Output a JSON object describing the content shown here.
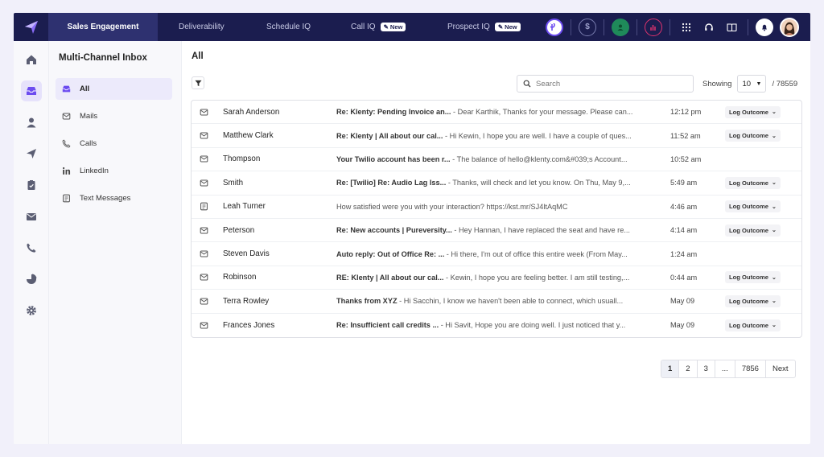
{
  "topnav": {
    "tabs": [
      {
        "label": "Sales Engagement",
        "active": true
      },
      {
        "label": "Deliverability"
      },
      {
        "label": "Schedule IQ"
      },
      {
        "label": "Call IQ",
        "badge": "✎ New"
      },
      {
        "label": "Prospect IQ",
        "badge": "✎ New"
      }
    ],
    "icons": [
      "play-circle-icon",
      "dollar-circle-icon",
      "user-circle-icon",
      "analytics-icon",
      "dialpad-icon",
      "headset-icon",
      "book-icon",
      "bell-icon",
      "avatar"
    ]
  },
  "rail": {
    "icons": [
      "home-icon",
      "inbox-icon",
      "contacts-icon",
      "send-icon",
      "tasks-icon",
      "mail-icon",
      "phone-icon",
      "reports-icon",
      "settings-icon"
    ],
    "active": "inbox-icon"
  },
  "subnav": {
    "title": "Multi-Channel Inbox",
    "items": [
      {
        "label": "All",
        "icon": "inbox-icon",
        "active": true
      },
      {
        "label": "Mails",
        "icon": "mail-icon"
      },
      {
        "label": "Calls",
        "icon": "phone-icon"
      },
      {
        "label": "LinkedIn",
        "icon": "linkedin-icon"
      },
      {
        "label": "Text Messages",
        "icon": "sms-icon"
      }
    ]
  },
  "main": {
    "title": "All",
    "search_placeholder": "Search",
    "showing_label": "Showing",
    "page_size": "10",
    "total": "/ 78559"
  },
  "rows": [
    {
      "type": "mail",
      "name": "Sarah Anderson",
      "subject": "Re: Klenty: Pending Invoice an...",
      "preview": " - Dear Karthik, Thanks for your message. Please can...",
      "time": "12:12 pm",
      "outcome": "Log Outcome"
    },
    {
      "type": "mail",
      "name": "Matthew Clark",
      "subject": "Re: Klenty | All about our cal...",
      "preview": " - Hi Kewin, I hope you are well. I have a couple of ques...",
      "time": "11:52 am",
      "outcome": "Log Outcome"
    },
    {
      "type": "mail",
      "name": "Thompson",
      "subject": "Your Twilio account has been r...",
      "preview": " - The balance of hello@klenty.com&#039;s Account...",
      "time": "10:52 am",
      "outcome": ""
    },
    {
      "type": "mail",
      "name": "Smith",
      "subject": "Re: [Twilio] Re: Audio Lag Iss...",
      "preview": " - Thanks, will check and let you know. On Thu, May 9,...",
      "time": "5:49 am",
      "outcome": "Log Outcome"
    },
    {
      "type": "sms",
      "name": "Leah Turner",
      "subject": "",
      "preview": "How satisfied were you with your interaction? https://kst.mr/SJ4ltAqMC",
      "time": "4:46 am",
      "outcome": "Log Outcome"
    },
    {
      "type": "mail",
      "name": "Peterson",
      "subject": "Re: New accounts | Pureversity...",
      "preview": " - Hey Hannan, I have replaced the seat and have re...",
      "time": "4:14 am",
      "outcome": "Log Outcome"
    },
    {
      "type": "mail",
      "name": "Steven Davis",
      "subject": "Auto reply: Out of Office Re: ...",
      "preview": " - Hi there, I'm out of office this entire week (From May...",
      "time": "1:24 am",
      "outcome": ""
    },
    {
      "type": "mail",
      "name": "Robinson",
      "subject": "RE: Klenty | All about our cal...",
      "preview": " - Kewin, I hope you are feeling better. I am still testing,...",
      "time": "0:44 am",
      "outcome": "Log Outcome"
    },
    {
      "type": "mail",
      "name": "Terra Rowley",
      "subject": "Thanks from XYZ",
      "preview": " - Hi Sacchin, I know we haven't been able to connect, which usuall...",
      "time": "May 09",
      "outcome": "Log Outcome"
    },
    {
      "type": "mail",
      "name": "Frances Jones",
      "subject": "Re: Insufficient call credits ...",
      "preview": " - Hi Savit, Hope you are doing well. I just noticed that y...",
      "time": "May 09",
      "outcome": "Log Outcome"
    }
  ],
  "pagination": [
    "1",
    "2",
    "3",
    "...",
    "7856",
    "Next"
  ],
  "colors": {
    "nav_bg": "#1b1d4f",
    "nav_active": "#2e3170",
    "accent": "#6c4cf0",
    "green": "#1f8a5a",
    "pink": "#e0336e"
  }
}
